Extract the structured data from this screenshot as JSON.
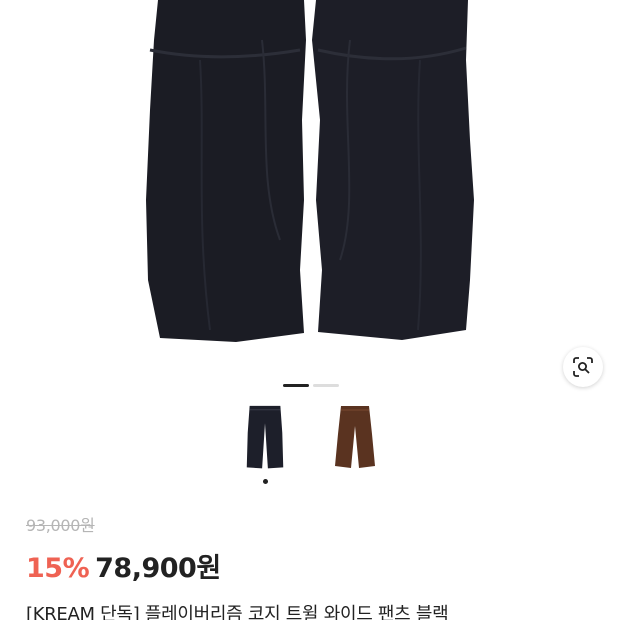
{
  "gallery": {
    "pager": {
      "count": 2,
      "active": 0
    },
    "thumbnails": [
      {
        "name": "black",
        "color": "#1d1f2a",
        "selected": true
      },
      {
        "name": "brown",
        "color": "#5a3320",
        "selected": false
      }
    ],
    "icons": {
      "lens": "lens-search-icon"
    }
  },
  "price": {
    "original": "93,000원",
    "discount": "15%",
    "sale": "78,900원",
    "discount_color": "#ef6253"
  },
  "product": {
    "title": "[KREAM 단독] 플레이버리즘 코지 트윌 와이드 팬츠 블랙"
  }
}
